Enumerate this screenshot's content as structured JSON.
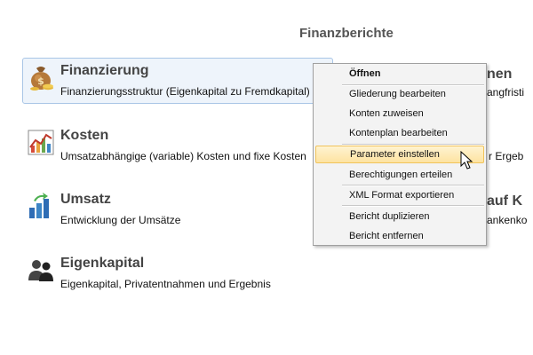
{
  "page": {
    "title": "Finanzberichte"
  },
  "reports": [
    {
      "icon": "money-bag-icon",
      "title": "Finanzierung",
      "desc": "Finanzierungsstruktur (Eigenkapital zu Fremdkapital)"
    },
    {
      "icon": "cost-chart-icon",
      "title": "Kosten",
      "desc": "Umsatzabhängige (variable) Kosten und fixe Kosten"
    },
    {
      "icon": "revenue-bar-chart-icon",
      "title": "Umsatz",
      "desc": "Entwicklung der Umsätze"
    },
    {
      "icon": "people-icon",
      "title": "Eigenkapital",
      "desc": "Eigenkapital, Privatentnahmen und Ergebnis"
    }
  ],
  "right_column": {
    "frag1_title": "nen",
    "frag1_desc": "angfristi",
    "frag2_desc": "r Ergeb",
    "frag3_title": "auf K",
    "frag3_desc": "ankenko"
  },
  "context_menu": {
    "items": [
      "Öffnen",
      "Gliederung bearbeiten",
      "Konten zuweisen",
      "Kontenplan bearbeiten",
      "Parameter einstellen",
      "Berechtigungen erteilen",
      "XML Format exportieren",
      "Bericht duplizieren",
      "Bericht entfernen"
    ],
    "hovered_index": 4
  }
}
